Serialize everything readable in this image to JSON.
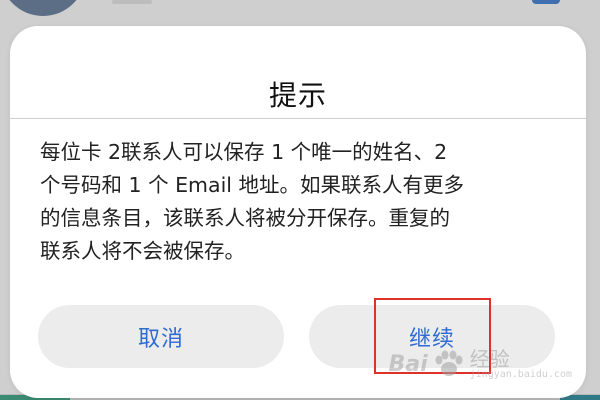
{
  "dialog": {
    "title": "提示",
    "message_lines": [
      "每位卡 2联系人可以保存 1 个唯一的姓名、2",
      "个号码和 1 个 Email 地址。如果联系人有更多",
      "的信息条目，该联系人将被分开保存。重复的",
      "联系人将不会被保存。"
    ],
    "cancel_label": "取消",
    "continue_label": "继续"
  },
  "watermark": {
    "brand": "Bai",
    "label": "经验",
    "url": "jingyan.baidu.com"
  },
  "colors": {
    "button_text": "#2e6bd3",
    "button_bg": "#ececec",
    "highlight": "#e0302a",
    "dialog_bg": "#ffffff"
  },
  "icons": {
    "watermark_icon": "paw-icon"
  }
}
